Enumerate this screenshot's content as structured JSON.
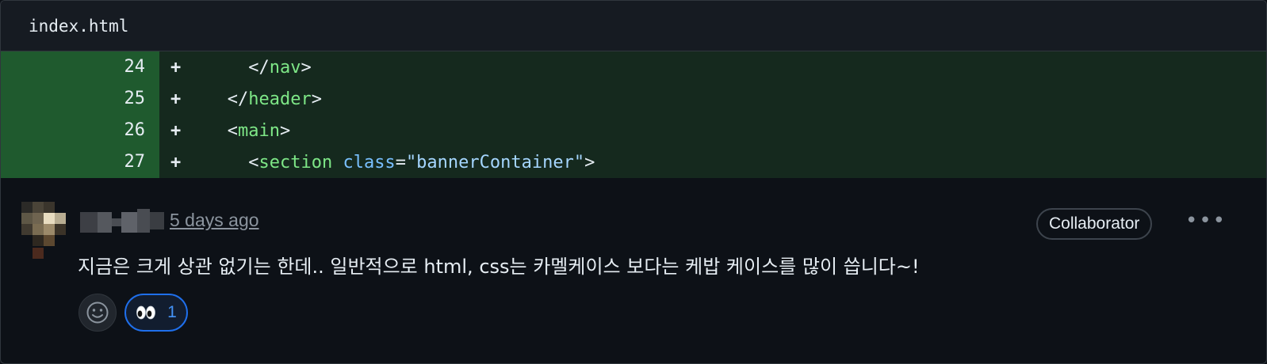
{
  "file": {
    "name": "index.html"
  },
  "diff": {
    "lines": [
      {
        "num": "24",
        "sign": "+",
        "indent": "     ",
        "open": "</",
        "tag": "nav",
        "close": ">"
      },
      {
        "num": "25",
        "sign": "+",
        "indent": "   ",
        "open": "</",
        "tag": "header",
        "close": ">"
      },
      {
        "num": "26",
        "sign": "+",
        "indent": "   ",
        "open": "<",
        "tag": "main",
        "close": ">"
      },
      {
        "num": "27",
        "sign": "+",
        "indent": "     ",
        "open": "<",
        "tag": "section",
        "attr": "class",
        "eq": "=",
        "value": "\"bannerContainer\"",
        "close": ">"
      }
    ]
  },
  "comment": {
    "timestamp": "5 days ago",
    "role_badge": "Collaborator",
    "more_label": "•••",
    "body": "지금은 크게 상관 없기는 한데.. 일반적으로 html, css는 카멜케이스 보다는 케밥 케이스를 많이 씁니다~!",
    "reaction": {
      "emoji": "eyes",
      "count": "1"
    }
  },
  "colors": {
    "bg": "#0d1117",
    "added_code_bg": "#15291e",
    "added_num_bg": "#1f5a2e",
    "tag": "#7ee787",
    "attr": "#79c0ff",
    "string": "#a5d6ff",
    "accent": "#1f6feb"
  }
}
